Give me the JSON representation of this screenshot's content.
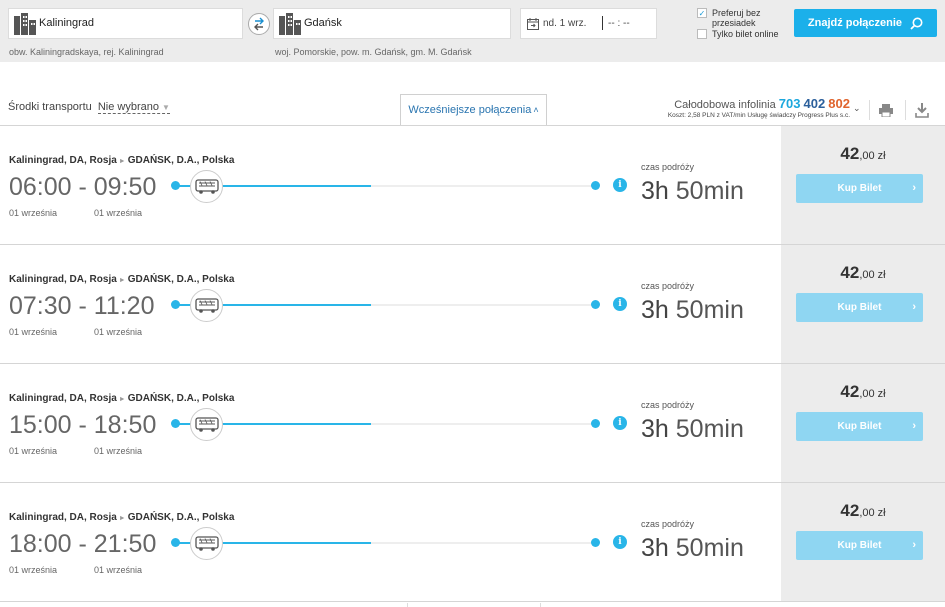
{
  "search": {
    "from": "Kaliningrad",
    "to": "Gdańsk",
    "from_region": "obw. Kaliningradskaya, rej. Kaliningrad",
    "to_region": "woj. Pomorskie, pow. m. Gdańsk, gm. M. Gdańsk",
    "date": "nd. 1 wrz.",
    "time": "-- : --",
    "opt_no_transfer": "Preferuj bez przesiadek",
    "opt_online": "Tylko bilet online",
    "find_label": "Znajdź połączenie"
  },
  "filters": {
    "transport_label": "Środki transportu",
    "transport_value": "Nie wybrano",
    "earlier_label": "Wcześniejsze połączenia"
  },
  "hotline": {
    "label": "Całodobowa infolinia",
    "num1": "703",
    "num2": "402",
    "num3": "802",
    "cost": "Koszt: 2,58 PLN z VAT/min Usługę świadczy Progress Plus s.c.",
    "colors": {
      "num1": "#1ba7dd",
      "num2": "#2b5f9b",
      "num3": "#e0642d"
    }
  },
  "connections": [
    {
      "origin": "Kaliningrad, DA, Rosja",
      "dest": "GDAŃSK, D.A., Polska",
      "depart": "06:00",
      "arrive": "09:50",
      "depart_date": "01 września",
      "arrive_date": "01 września",
      "dur_label": "czas podróży",
      "dur_h": "3h",
      "dur_m": "50min",
      "price_main": "42",
      "price_sub": ",00 zł",
      "buy": "Kup Bilet"
    },
    {
      "origin": "Kaliningrad, DA, Rosja",
      "dest": "GDAŃSK, D.A., Polska",
      "depart": "07:30",
      "arrive": "11:20",
      "depart_date": "01 września",
      "arrive_date": "01 września",
      "dur_label": "czas podróży",
      "dur_h": "3h",
      "dur_m": "50min",
      "price_main": "42",
      "price_sub": ",00 zł",
      "buy": "Kup Bilet"
    },
    {
      "origin": "Kaliningrad, DA, Rosja",
      "dest": "GDAŃSK, D.A., Polska",
      "depart": "15:00",
      "arrive": "18:50",
      "depart_date": "01 września",
      "arrive_date": "01 września",
      "dur_label": "czas podróży",
      "dur_h": "3h",
      "dur_m": "50min",
      "price_main": "42",
      "price_sub": ",00 zł",
      "buy": "Kup Bilet"
    },
    {
      "origin": "Kaliningrad, DA, Rosja",
      "dest": "GDAŃSK, D.A., Polska",
      "depart": "18:00",
      "arrive": "21:50",
      "depart_date": "01 września",
      "arrive_date": "01 września",
      "dur_label": "czas podróży",
      "dur_h": "3h",
      "dur_m": "50min",
      "price_main": "42",
      "price_sub": ",00 zł",
      "buy": "Kup Bilet"
    }
  ],
  "icons": {
    "city": "city-icon",
    "swap": "swap-icon",
    "calendar": "calendar-icon",
    "search": "search-icon",
    "bus": "bus-icon",
    "info": "info-icon",
    "print": "print-icon",
    "download": "download-icon"
  },
  "colors": {
    "accent": "#1bb0ea",
    "buy_disabled": "#8fd6f2",
    "line": "#29b5e8"
  }
}
